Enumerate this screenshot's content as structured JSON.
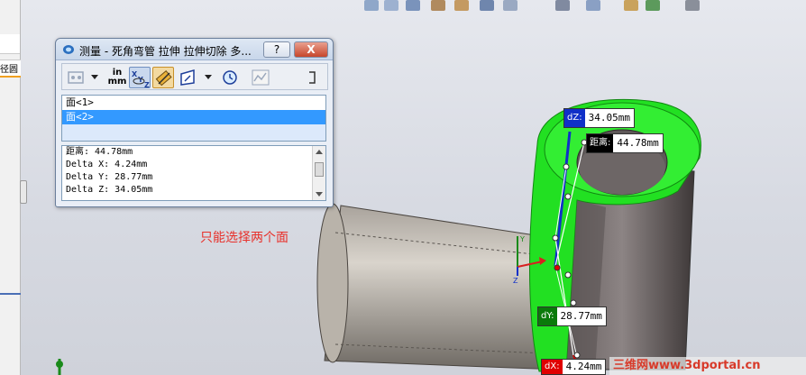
{
  "left_panel": {
    "tab_label": "径圆"
  },
  "measure_window": {
    "title": "测量 - 死角弯管 拉伸 拉伸切除 多...",
    "help_label": "?",
    "close_label": "X",
    "units_label": "in mm",
    "selections": [
      {
        "label": "面<1>",
        "selected": false
      },
      {
        "label": "面<2>",
        "selected": true
      }
    ],
    "results": [
      "距离: 44.78mm",
      "Delta X: 4.24mm",
      "Delta Y: 28.77mm",
      "Delta Z: 34.05mm"
    ]
  },
  "annotation": {
    "note": "只能选择两个面",
    "color": "#e8302a"
  },
  "dimensions": {
    "dz": {
      "tag": "dZ:",
      "value": "34.05mm",
      "color": "#1030c8"
    },
    "distance": {
      "tag": "距离:",
      "value": "44.78mm",
      "color": "#000000"
    },
    "dy": {
      "tag": "dY:",
      "value": "28.77mm",
      "color": "#0a7a0a"
    },
    "dx": {
      "tag": "dX:",
      "value": "4.24mm",
      "color": "#e00000"
    }
  },
  "triad": {
    "y": "Y",
    "z": "Z"
  },
  "watermark": {
    "text": "三维网www.3dportal.cn"
  }
}
